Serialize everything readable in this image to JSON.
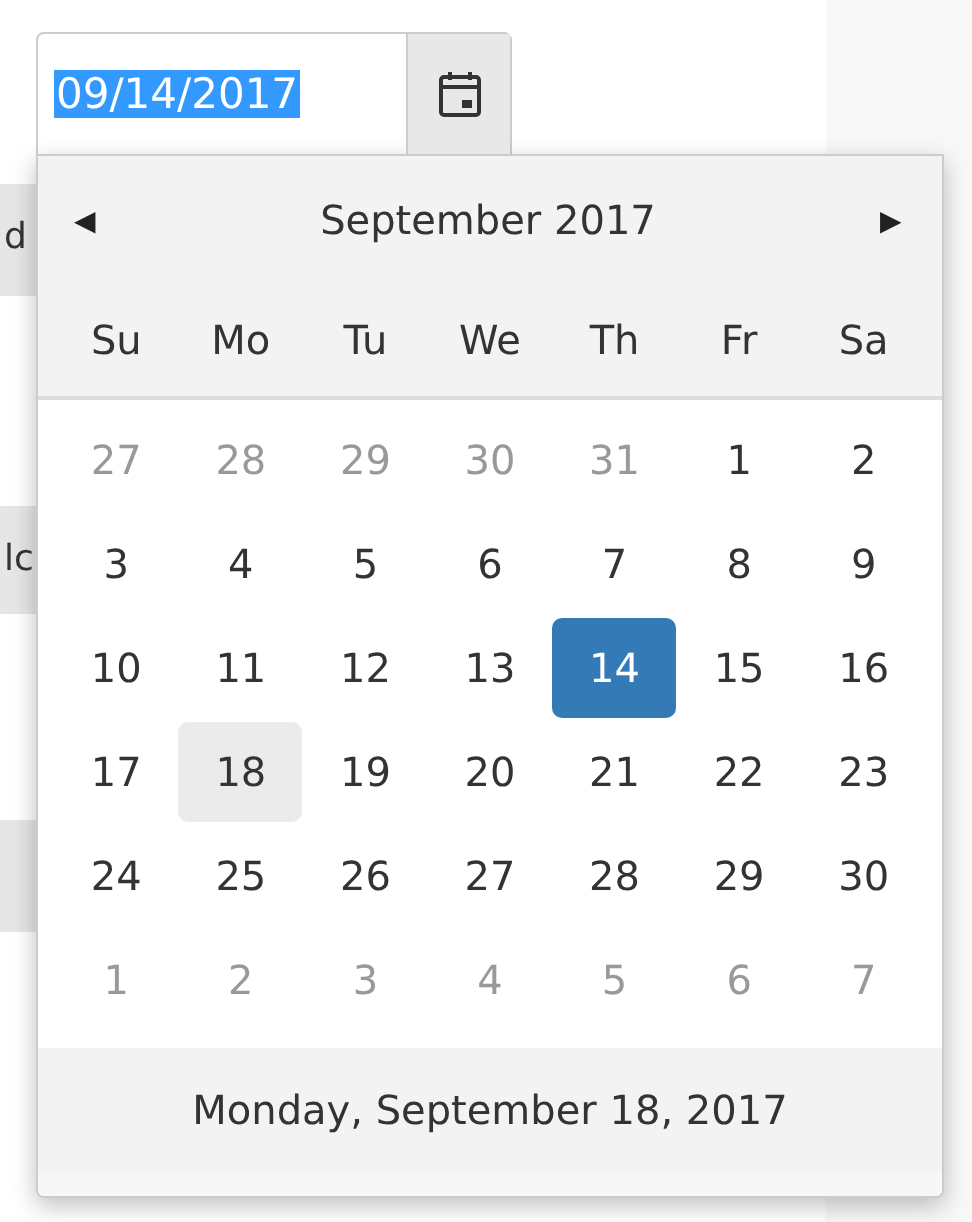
{
  "background": {
    "fragments": [
      "d",
      "lc"
    ]
  },
  "date_input": {
    "value": "09/14/2017",
    "text_selected": true
  },
  "calendar": {
    "month_title": "September 2017",
    "prev": "◀",
    "next": "▶",
    "weekdays": [
      "Su",
      "Mo",
      "Tu",
      "We",
      "Th",
      "Fr",
      "Sa"
    ],
    "days": [
      {
        "label": "27",
        "kind": "other",
        "selected": false,
        "focused": false
      },
      {
        "label": "28",
        "kind": "other",
        "selected": false,
        "focused": false
      },
      {
        "label": "29",
        "kind": "other",
        "selected": false,
        "focused": false
      },
      {
        "label": "30",
        "kind": "other",
        "selected": false,
        "focused": false
      },
      {
        "label": "31",
        "kind": "other",
        "selected": false,
        "focused": false
      },
      {
        "label": "1",
        "kind": "current",
        "selected": false,
        "focused": false
      },
      {
        "label": "2",
        "kind": "current",
        "selected": false,
        "focused": false
      },
      {
        "label": "3",
        "kind": "current",
        "selected": false,
        "focused": false
      },
      {
        "label": "4",
        "kind": "current",
        "selected": false,
        "focused": false
      },
      {
        "label": "5",
        "kind": "current",
        "selected": false,
        "focused": false
      },
      {
        "label": "6",
        "kind": "current",
        "selected": false,
        "focused": false
      },
      {
        "label": "7",
        "kind": "current",
        "selected": false,
        "focused": false
      },
      {
        "label": "8",
        "kind": "current",
        "selected": false,
        "focused": false
      },
      {
        "label": "9",
        "kind": "current",
        "selected": false,
        "focused": false
      },
      {
        "label": "10",
        "kind": "current",
        "selected": false,
        "focused": false
      },
      {
        "label": "11",
        "kind": "current",
        "selected": false,
        "focused": false
      },
      {
        "label": "12",
        "kind": "current",
        "selected": false,
        "focused": false
      },
      {
        "label": "13",
        "kind": "current",
        "selected": false,
        "focused": false
      },
      {
        "label": "14",
        "kind": "current",
        "selected": true,
        "focused": false
      },
      {
        "label": "15",
        "kind": "current",
        "selected": false,
        "focused": false
      },
      {
        "label": "16",
        "kind": "current",
        "selected": false,
        "focused": false
      },
      {
        "label": "17",
        "kind": "current",
        "selected": false,
        "focused": false
      },
      {
        "label": "18",
        "kind": "current",
        "selected": false,
        "focused": true
      },
      {
        "label": "19",
        "kind": "current",
        "selected": false,
        "focused": false
      },
      {
        "label": "20",
        "kind": "current",
        "selected": false,
        "focused": false
      },
      {
        "label": "21",
        "kind": "current",
        "selected": false,
        "focused": false
      },
      {
        "label": "22",
        "kind": "current",
        "selected": false,
        "focused": false
      },
      {
        "label": "23",
        "kind": "current",
        "selected": false,
        "focused": false
      },
      {
        "label": "24",
        "kind": "current",
        "selected": false,
        "focused": false
      },
      {
        "label": "25",
        "kind": "current",
        "selected": false,
        "focused": false
      },
      {
        "label": "26",
        "kind": "current",
        "selected": false,
        "focused": false
      },
      {
        "label": "27",
        "kind": "current",
        "selected": false,
        "focused": false
      },
      {
        "label": "28",
        "kind": "current",
        "selected": false,
        "focused": false
      },
      {
        "label": "29",
        "kind": "current",
        "selected": false,
        "focused": false
      },
      {
        "label": "30",
        "kind": "current",
        "selected": false,
        "focused": false
      },
      {
        "label": "1",
        "kind": "other",
        "selected": false,
        "focused": false
      },
      {
        "label": "2",
        "kind": "other",
        "selected": false,
        "focused": false
      },
      {
        "label": "3",
        "kind": "other",
        "selected": false,
        "focused": false
      },
      {
        "label": "4",
        "kind": "other",
        "selected": false,
        "focused": false
      },
      {
        "label": "5",
        "kind": "other",
        "selected": false,
        "focused": false
      },
      {
        "label": "6",
        "kind": "other",
        "selected": false,
        "focused": false
      },
      {
        "label": "7",
        "kind": "other",
        "selected": false,
        "focused": false
      }
    ],
    "footer": "Monday, September 18, 2017"
  }
}
